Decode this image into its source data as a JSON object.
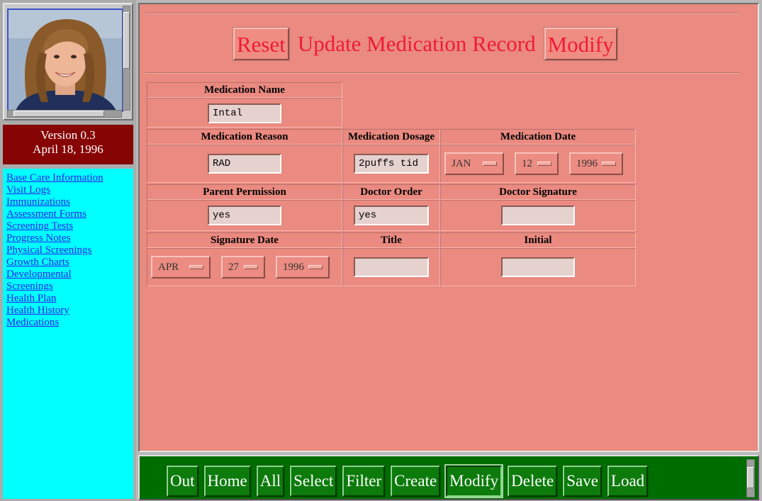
{
  "sidebar": {
    "version": "Version 0.3",
    "date": "April 18, 1996",
    "links": [
      "Base Care Information",
      "Visit Logs",
      "Immunizations",
      "Assessment Forms",
      "Screening Tests",
      "Progress Notes",
      "Physical Screenings",
      "Growth Charts",
      "Developmental",
      "Screenings",
      "Health Plan",
      "Health History",
      "Medications"
    ]
  },
  "header": {
    "reset_label": "Reset",
    "title": "Update Medication Record",
    "modify_label": "Modify"
  },
  "form": {
    "medication_name": {
      "label": "Medication Name",
      "value": "Intal"
    },
    "medication_reason": {
      "label": "Medication Reason",
      "value": "RAD"
    },
    "medication_dosage": {
      "label": "Medication Dosage",
      "value": "2puffs tid"
    },
    "medication_date": {
      "label": "Medication Date",
      "month": "JAN",
      "day": "12",
      "year": "1996"
    },
    "parent_permission": {
      "label": "Parent Permission",
      "value": "yes"
    },
    "doctor_order": {
      "label": "Doctor Order",
      "value": "yes"
    },
    "doctor_signature": {
      "label": "Doctor Signature",
      "value": ""
    },
    "signature_date": {
      "label": "Signature Date",
      "month": "APR",
      "day": "27",
      "year": "1996"
    },
    "title": {
      "label": "Title",
      "value": ""
    },
    "initial": {
      "label": "Initial",
      "value": ""
    }
  },
  "toolbar": {
    "buttons": [
      "Out",
      "Home",
      "All",
      "Select",
      "Filter",
      "Create",
      "Modify",
      "Delete",
      "Save",
      "Load"
    ],
    "active": "Modify"
  },
  "colors": {
    "panel": "#ea8a80",
    "title_red": "#ef1b36",
    "nav_bg": "#00ffff",
    "version_bg": "#860404",
    "toolbar_bg": "#006d00"
  }
}
